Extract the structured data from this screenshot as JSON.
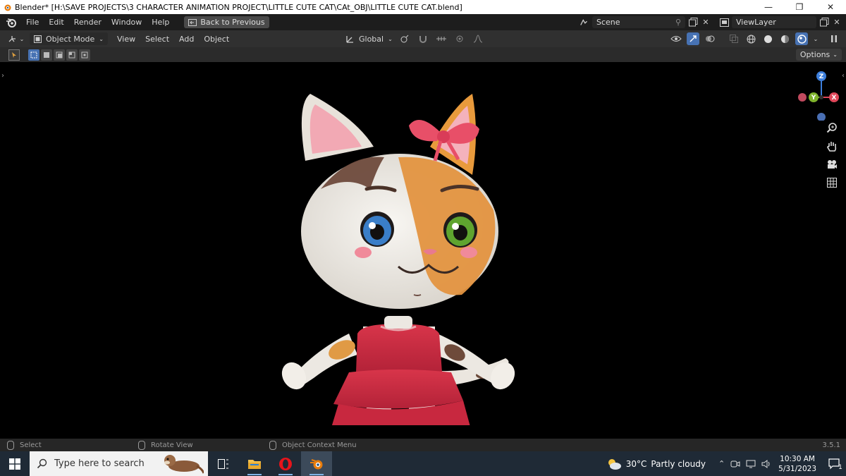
{
  "window": {
    "title": "Blender* [H:\\SAVE PROJECTS\\3 CHARACTER ANIMATION PROJECT\\LITTLE CUTE CAT\\CAt_OBJ\\LITTLE CUTE CAT.blend]",
    "minimize": "—",
    "maximize": "❐",
    "close": "✕"
  },
  "topbar": {
    "menus": [
      "File",
      "Edit",
      "Render",
      "Window",
      "Help"
    ],
    "back_button": "Back to Previous",
    "scene": "Scene",
    "view_layer": "ViewLayer"
  },
  "viewport_header": {
    "mode": "Object Mode",
    "menus": [
      "View",
      "Select",
      "Add",
      "Object"
    ],
    "transform_orientation": "Global"
  },
  "tool_settings": {
    "options": "Options"
  },
  "gizmo": {
    "x": "X",
    "y": "Y",
    "z": "Z",
    "colors": {
      "x": "#e0475a",
      "y": "#7fb32c",
      "z": "#3d7fdc",
      "neg": "#4a6fb3"
    }
  },
  "statusbar": {
    "select": "Select",
    "rotate": "Rotate View",
    "context": "Object Context Menu",
    "version": "3.5.1"
  },
  "taskbar": {
    "search_placeholder": "Type here to search",
    "weather_temp": "30°C",
    "weather_desc": "Partly cloudy",
    "time": "10:30 AM",
    "date": "5/31/2023",
    "notification_count": "1"
  }
}
